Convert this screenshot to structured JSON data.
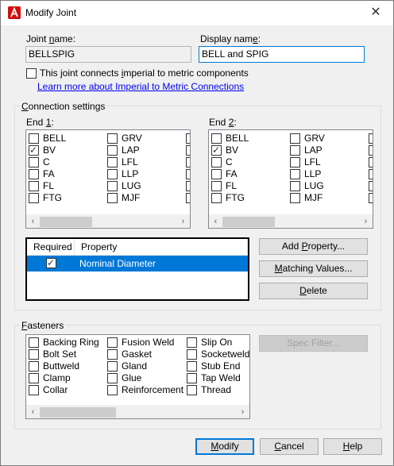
{
  "window": {
    "title": "Modify Joint",
    "close_glyph": "✕"
  },
  "joint_name": {
    "label_pre": "Joint ",
    "label_u": "n",
    "label_post": "ame:",
    "value": "BELLSPIG"
  },
  "display_name": {
    "label_pre": "Display nam",
    "label_u": "e",
    "label_post": ":",
    "value": "BELL and SPIG"
  },
  "metric": {
    "label_pre": "This joint connects ",
    "label_u": "i",
    "label_post": "mperial to metric components",
    "checked": false
  },
  "learn_link": "Learn more about Imperial to Metric Connections",
  "connection": {
    "title_pre": "",
    "title_u": "C",
    "title_post": "onnection settings",
    "end1": {
      "label_pre": "End ",
      "label_u": "1",
      "label_post": ":",
      "col1": [
        {
          "label": "BELL",
          "checked": false
        },
        {
          "label": "BV",
          "checked": true
        },
        {
          "label": "C",
          "checked": false
        },
        {
          "label": "FA",
          "checked": false
        },
        {
          "label": "FL",
          "checked": false
        },
        {
          "label": "FTG",
          "checked": false
        }
      ],
      "col2": [
        {
          "label": "GRV",
          "checked": false
        },
        {
          "label": "LAP",
          "checked": false
        },
        {
          "label": "LFL",
          "checked": false
        },
        {
          "label": "LLP",
          "checked": false
        },
        {
          "label": "LUG",
          "checked": false
        },
        {
          "label": "MJF",
          "checked": false
        }
      ]
    },
    "end2": {
      "label_pre": "End ",
      "label_u": "2",
      "label_post": ":",
      "col1": [
        {
          "label": "BELL",
          "checked": false
        },
        {
          "label": "BV",
          "checked": true
        },
        {
          "label": "C",
          "checked": false
        },
        {
          "label": "FA",
          "checked": false
        },
        {
          "label": "FL",
          "checked": false
        },
        {
          "label": "FTG",
          "checked": false
        }
      ],
      "col2": [
        {
          "label": "GRV",
          "checked": false
        },
        {
          "label": "LAP",
          "checked": false
        },
        {
          "label": "LFL",
          "checked": false
        },
        {
          "label": "LLP",
          "checked": false
        },
        {
          "label": "LUG",
          "checked": false
        },
        {
          "label": "MJF",
          "checked": false
        }
      ]
    },
    "properties": {
      "headers": [
        "Required",
        "Property"
      ],
      "rows": [
        {
          "required": true,
          "property": "Nominal Diameter"
        }
      ]
    },
    "buttons": {
      "add_pre": "Add ",
      "add_u": "P",
      "add_post": "roperty...",
      "match_pre": "",
      "match_u": "M",
      "match_post": "atching Values...",
      "delete_pre": "",
      "delete_u": "D",
      "delete_post": "elete"
    }
  },
  "fasteners": {
    "title_pre": "",
    "title_u": "F",
    "title_post": "asteners",
    "col1": [
      "Backing Ring",
      "Bolt Set",
      "Buttweld",
      "Clamp",
      "Collar"
    ],
    "col2": [
      "Fusion Weld",
      "Gasket",
      "Gland",
      "Glue",
      "Reinforcement Ring"
    ],
    "col3": [
      "Slip On",
      "Socketweld",
      "Stub End",
      "Tap Weld",
      "Thread"
    ],
    "spec_filter": "Spec Filter..."
  },
  "footer": {
    "modify_pre": "",
    "modify_u": "M",
    "modify_post": "odify",
    "cancel_pre": "",
    "cancel_u": "C",
    "cancel_post": "ancel",
    "help_pre": "",
    "help_u": "H",
    "help_post": "elp"
  },
  "colors": {
    "accent": "#0078d7",
    "selection": "#0078d7",
    "link": "#0000ee",
    "icon_red": "#d01010"
  }
}
